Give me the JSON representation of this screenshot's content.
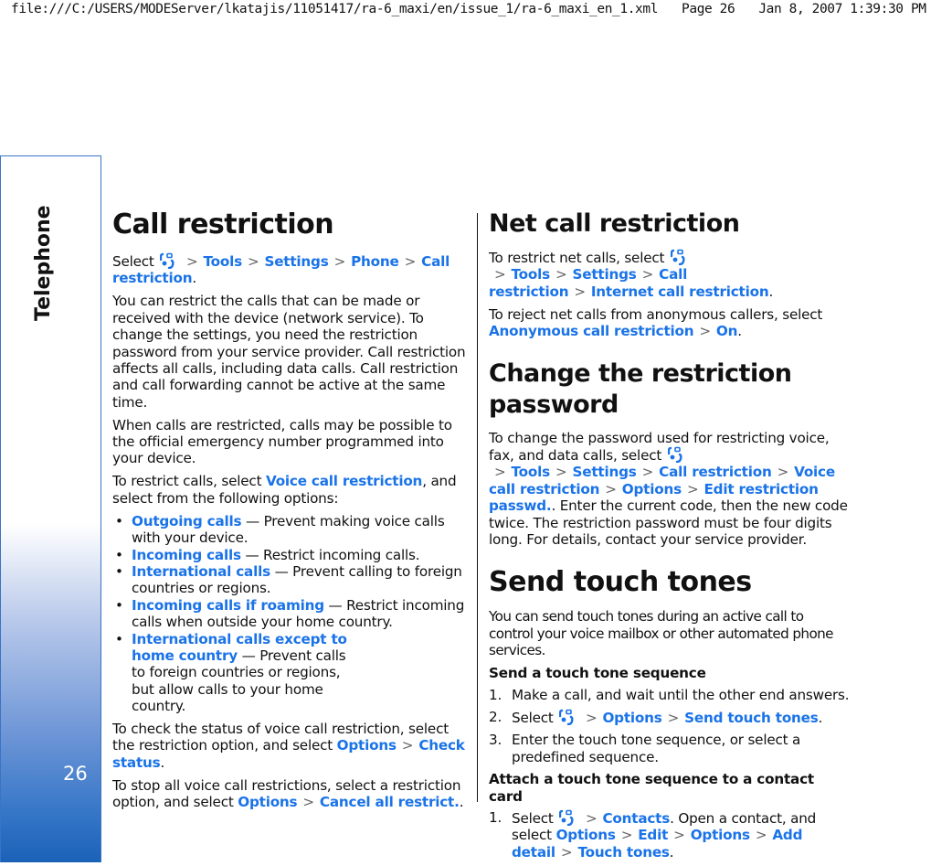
{
  "header": {
    "file_path": "file:///C:/USERS/MODEServer/lkatajis/11051417/ra-6_maxi/en/issue_1/ra-6_maxi_en_1.xml",
    "page_label": "Page 26",
    "timestamp": "Jan 8, 2007 1:39:30 PM"
  },
  "sidebar": {
    "section_title": "Telephone",
    "page_number": "26",
    "gradient_bottom_color": "#1a62b8"
  },
  "colors": {
    "link": "#1a73e8",
    "text": "#111111"
  },
  "left": {
    "title": "Call restriction",
    "path_intro": "Select",
    "path": [
      "Tools",
      "Settings",
      "Phone",
      "Call restriction"
    ],
    "intro": "You can restrict the calls that can be made or received with the device (network service). To change the settings, you need the restriction password from your service provider. Call restriction affects all calls, including data calls. Call restriction and call forwarding cannot be active at the same time.",
    "emergency": "When calls are restricted, calls may be possible to the official emergency number programmed into your device.",
    "restrict_pre": "To restrict calls, select",
    "restrict_link": "Voice call restriction",
    "restrict_post": ", and select from the following options:",
    "options": [
      {
        "label": "Outgoing calls",
        "desc": " — Prevent making voice calls with your device."
      },
      {
        "label": "Incoming calls",
        "desc": " — Restrict incoming calls."
      },
      {
        "label": "International calls",
        "desc": " — Prevent calling to foreign countries or regions."
      },
      {
        "label": "Incoming calls if roaming",
        "desc": " — Restrict incoming calls when outside your home country."
      },
      {
        "label": "International calls except to home country",
        "desc": " — Prevent calls to foreign countries or regions, but allow calls to your home country."
      }
    ],
    "check_pre": "To check the status of voice call restriction, select the restriction option, and select",
    "check_path": [
      "Options",
      "Check status"
    ],
    "stop_pre": "To stop all voice call restrictions, select a restriction option, and select",
    "stop_path": [
      "Options",
      "Cancel all restrict."
    ]
  },
  "right": {
    "net": {
      "title": "Net call restriction",
      "p1_pre": "To restrict net calls, select",
      "p1_path": [
        "Tools",
        "Settings",
        "Call restriction",
        "Internet call restriction"
      ],
      "p2_pre": "To reject net calls from anonymous callers, select",
      "p2_path": [
        "Anonymous call restriction",
        "On"
      ]
    },
    "password": {
      "title": "Change the restriction password",
      "pre": "To change the password used for restricting voice, fax, and data calls, select",
      "path": [
        "Tools",
        "Settings",
        "Call restriction",
        "Voice call restriction",
        "Options",
        "Edit restriction passwd."
      ],
      "post": ". Enter the current code, then the new code twice. The restriction password must be four digits long. For details, contact your service provider."
    },
    "touch": {
      "title": "Send touch tones",
      "intro": "You can send touch tones during an active call to control your voice mailbox or other automated phone services.",
      "send_heading": "Send a touch tone sequence",
      "send_steps": [
        {
          "num": "1.",
          "text": "Make a call, and wait until the other end answers."
        },
        {
          "num": "2.",
          "pre": "Select",
          "path": [
            "Options",
            "Send touch tones"
          ]
        },
        {
          "num": "3.",
          "text": "Enter the touch tone sequence, or select a predefined sequence."
        }
      ],
      "attach_heading": "Attach a touch tone sequence to a contact card",
      "attach_steps": [
        {
          "num": "1.",
          "pre": "Select",
          "path1": [
            "Contacts"
          ],
          "mid": ". Open a contact, and select ",
          "path2": [
            "Options",
            "Edit",
            "Options",
            "Add detail",
            "Touch tones"
          ]
        }
      ]
    }
  }
}
